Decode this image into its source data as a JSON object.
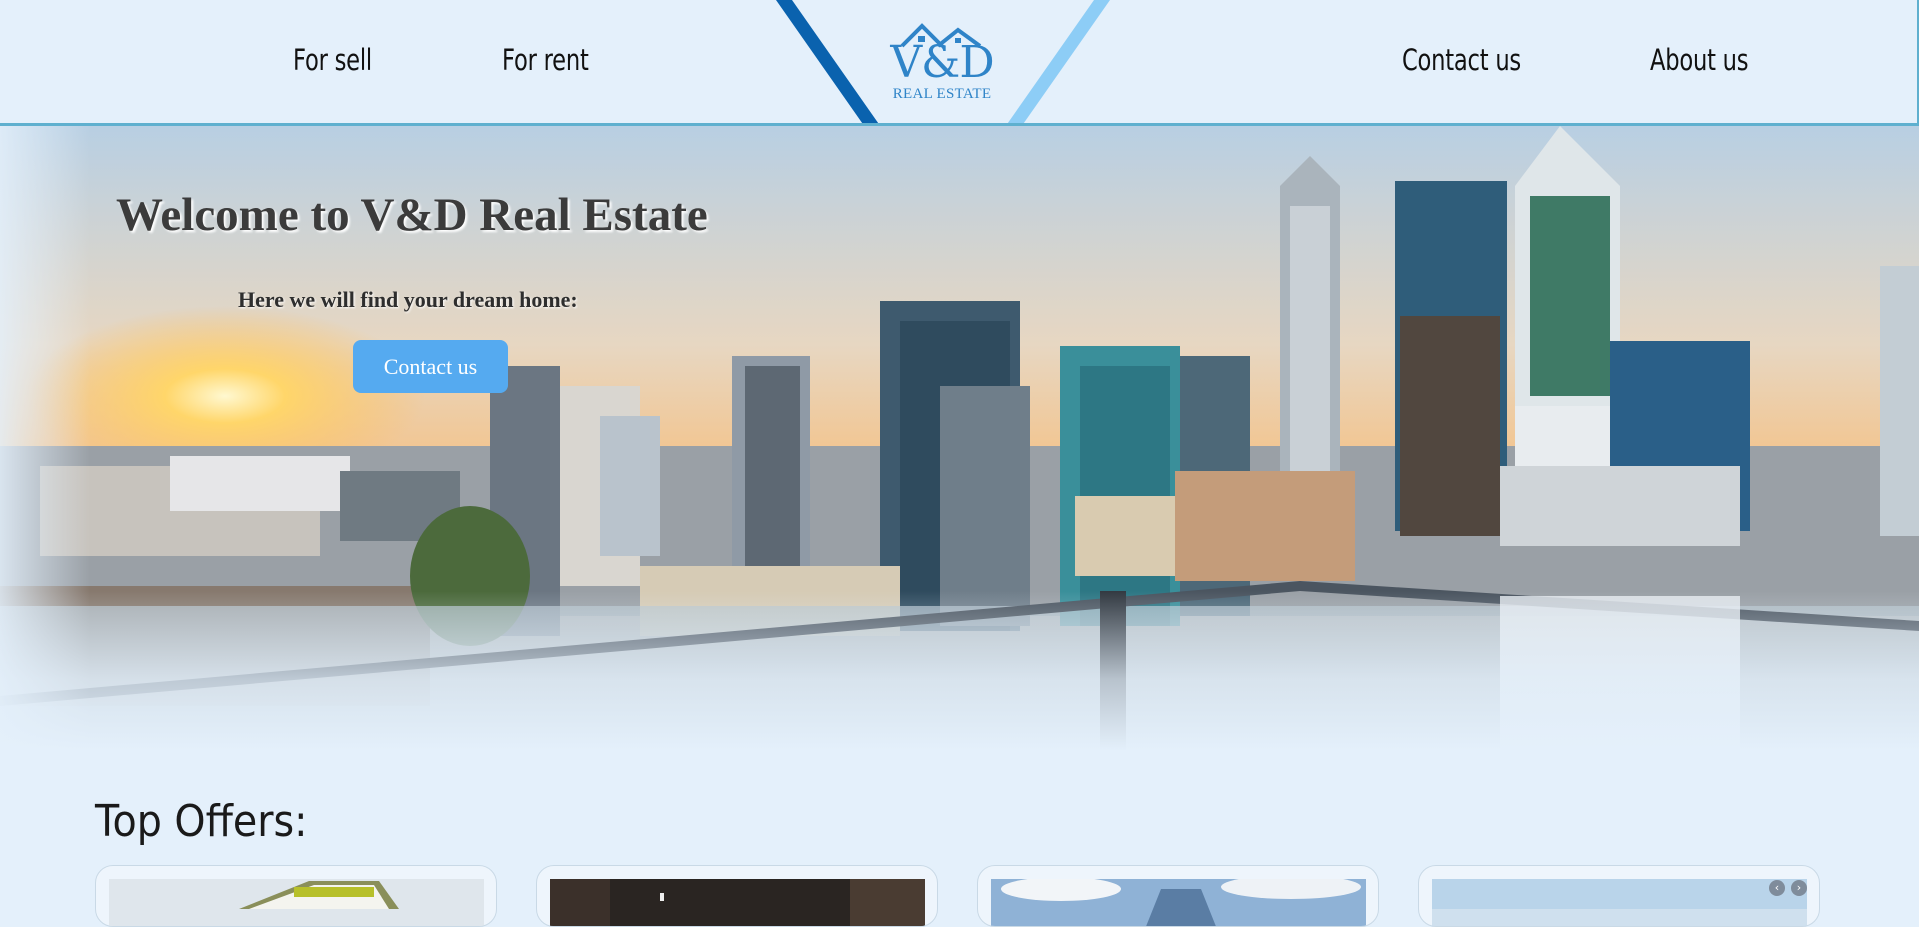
{
  "nav": {
    "left": [
      "For sell",
      "For rent"
    ],
    "right": [
      "Contact us",
      "About us"
    ]
  },
  "logo": {
    "mark": "V&D",
    "subtitle": "REAL ESTATE",
    "color": "#2f84c8"
  },
  "hero": {
    "title": "Welcome to V&D Real Estate",
    "subtitle": "Here we will find your dream home:",
    "button_label": "Contact us",
    "button_color": "#55aaf0"
  },
  "offers": {
    "title": "Top Offers:",
    "cards": [
      {
        "image": "building-photo"
      },
      {
        "image": "interior-photo"
      },
      {
        "image": "tower-photo"
      },
      {
        "image": "sky-photo",
        "prev_icon": "‹",
        "next_icon": "›"
      }
    ]
  },
  "colors": {
    "background": "#e4f0fb",
    "stripe_dark": "#0a62ae",
    "stripe_light": "#8dcdf6",
    "header_border": "#5fb0cf"
  }
}
